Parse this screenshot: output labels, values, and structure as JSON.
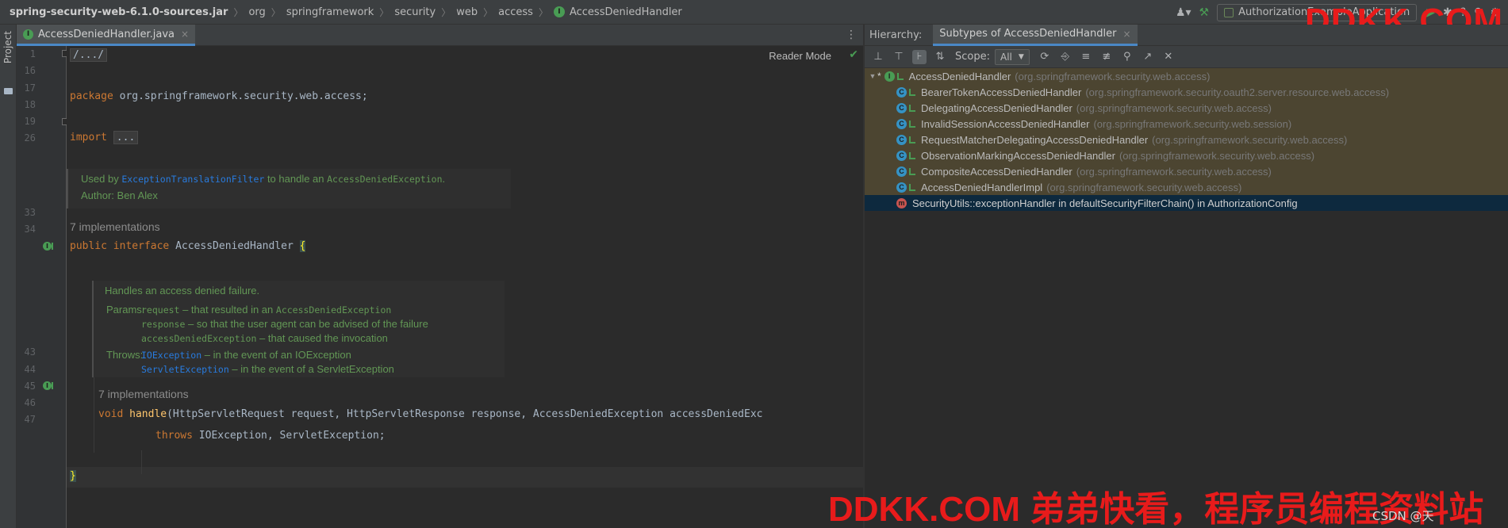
{
  "breadcrumb": {
    "items": [
      "spring-security-web-6.1.0-sources.jar",
      "org",
      "springframework",
      "security",
      "web",
      "access",
      "AccessDeniedHandler"
    ]
  },
  "toolbar": {
    "run_config": "AuthorizationExampleApplication"
  },
  "watermarks": {
    "top": "DDKK.COM",
    "bottom": "DDKK.COM 弟弟快看，程序员编程资料站",
    "csdn": "CSDN @天"
  },
  "left_strip": {
    "project_label": "Project"
  },
  "editor": {
    "tab_label": "AccessDeniedHandler.java",
    "reader_mode": "Reader Mode",
    "line_numbers": {
      "l1": "1",
      "l16": "16",
      "l17": "17",
      "l18": "18",
      "l19": "19",
      "l26": "26",
      "l33": "33",
      "l34": "34",
      "l43": "43",
      "l44": "44",
      "l45": "45",
      "l46": "46",
      "l47": "47"
    },
    "code": {
      "header_fold": "/.../",
      "package_kw": "package",
      "package_name": " org.springframework.security.web.access;",
      "import_kw": "import",
      "import_fold": "...",
      "public_kw": "public",
      "interface_kw": "interface",
      "interface_name": " AccessDeniedHandler ",
      "open_brace": "{",
      "void_kw": "void",
      "method_name": "handle",
      "method_params": "(HttpServletRequest request, HttpServletResponse response, AccessDeniedException accessDeniedExc",
      "throws_kw": "throws",
      "throws_list": " IOException, ServletException;",
      "close_brace": "}"
    },
    "class_doc": {
      "used_by_prefix": "Used by ",
      "used_by_link": "ExceptionTranslationFilter",
      "used_by_mid": " to handle an ",
      "used_by_type": "AccessDeniedException",
      "used_by_end": ".",
      "author": "Author: Ben Alex"
    },
    "class_impls": "7 implementations",
    "method_doc": {
      "summary": "Handles an access denied failure.",
      "params_label": "Params:",
      "param1_name": "request",
      "param1_desc": " – that resulted in an ",
      "param1_type": "AccessDeniedException",
      "param2_name": "response",
      "param2_desc": " – so that the user agent can be advised of the failure",
      "param3_name": "accessDeniedException",
      "param3_desc": " – that caused the invocation",
      "throws_label": "Throws:",
      "throw1_name": "IOException",
      "throw1_desc": " – in the event of an IOException",
      "throw2_name": "ServletException",
      "throw2_desc": " – in the event of a ServletException"
    },
    "method_impls": "7 implementations"
  },
  "hierarchy": {
    "label": "Hierarchy:",
    "tab": "Subtypes of AccessDeniedHandler",
    "scope_label": "Scope:",
    "scope_value": "All",
    "root": {
      "name": "AccessDeniedHandler",
      "pkg": "(org.springframework.security.web.access)"
    },
    "children": [
      {
        "name": "BearerTokenAccessDeniedHandler",
        "pkg": "(org.springframework.security.oauth2.server.resource.web.access)"
      },
      {
        "name": "DelegatingAccessDeniedHandler",
        "pkg": "(org.springframework.security.web.access)"
      },
      {
        "name": "InvalidSessionAccessDeniedHandler",
        "pkg": "(org.springframework.security.web.session)"
      },
      {
        "name": "RequestMatcherDelegatingAccessDeniedHandler",
        "pkg": "(org.springframework.security.web.access)"
      },
      {
        "name": "ObservationMarkingAccessDeniedHandler",
        "pkg": "(org.springframework.security.web.access)"
      },
      {
        "name": "CompositeAccessDeniedHandler",
        "pkg": "(org.springframework.security.web.access)"
      },
      {
        "name": "AccessDeniedHandlerImpl",
        "pkg": "(org.springframework.security.web.access)"
      }
    ],
    "lambda": "SecurityUtils::exceptionHandler in defaultSecurityFilterChain() in AuthorizationConfig"
  }
}
